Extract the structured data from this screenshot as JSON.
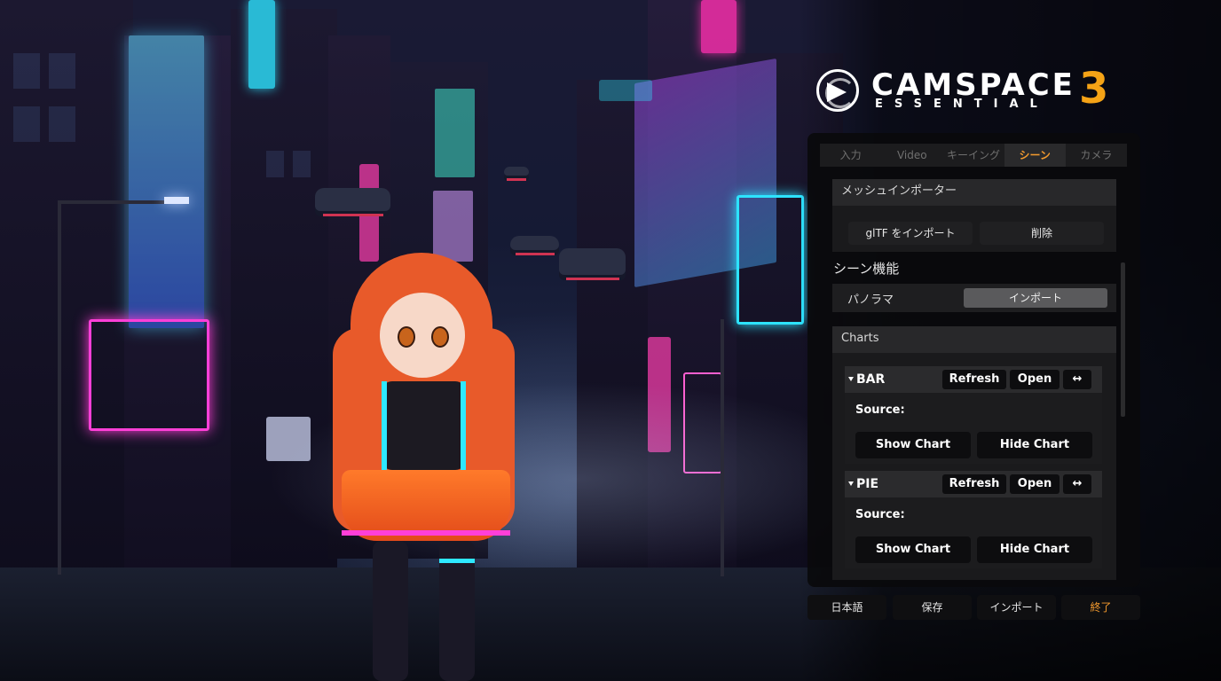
{
  "logo": {
    "brand": "CAMSPACE",
    "version": "3",
    "edition": "ESSENTIAL",
    "icon": "camera-aperture-play-icon"
  },
  "tabs": [
    {
      "label": "入力",
      "active": false
    },
    {
      "label": "Video",
      "active": false
    },
    {
      "label": "キーイング",
      "active": false
    },
    {
      "label": "シーン",
      "active": true
    },
    {
      "label": "カメラ",
      "active": false
    }
  ],
  "mesh_importer": {
    "title": "メッシュインポーター",
    "import_label": "glTF をインポート",
    "delete_label": "削除"
  },
  "scene_features": {
    "title": "シーン機能",
    "panorama_label": "パノラマ",
    "panorama_import_label": "インポート"
  },
  "charts": {
    "title": "Charts",
    "items": [
      {
        "name": "BAR",
        "refresh_label": "Refresh",
        "open_label": "Open",
        "swap_label": "↔",
        "source_label": "Source:",
        "show_label": "Show Chart",
        "hide_label": "Hide Chart"
      },
      {
        "name": "PIE",
        "refresh_label": "Refresh",
        "open_label": "Open",
        "swap_label": "↔",
        "source_label": "Source:",
        "show_label": "Show Chart",
        "hide_label": "Hide Chart"
      }
    ]
  },
  "footer": {
    "language_label": "日本語",
    "save_label": "保存",
    "import_label": "インポート",
    "exit_label": "終了"
  },
  "colors": {
    "accent": "#f39a2e",
    "panel_bg": "#0a0a0c",
    "logo_number": "#f5a316"
  }
}
